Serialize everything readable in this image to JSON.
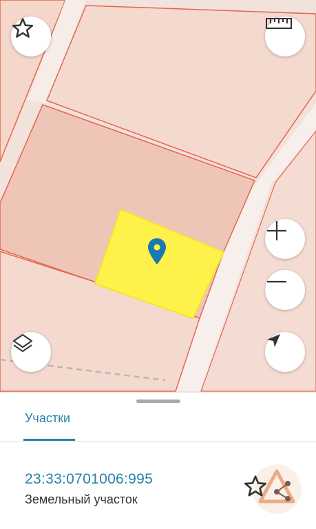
{
  "map": {
    "favorite_icon": "star-outline-icon",
    "ruler_icon": "ruler-icon",
    "zoom_in_icon": "plus-icon",
    "zoom_out_icon": "minus-icon",
    "layers_icon": "layers-icon",
    "locate_icon": "navigation-arrow-icon",
    "marker_icon": "map-pin-icon",
    "colors": {
      "background": "#f2e2dc",
      "parcel": "#efc8bc",
      "parcel_border": "#e5654e",
      "selected_parcel": "#fef24a",
      "marker": "#1b78b3"
    }
  },
  "sheet": {
    "tab_label": "Участки",
    "parcel": {
      "cadastral_number": "23:33:0701006:995",
      "type": "Земельный участок"
    },
    "favorite_icon": "star-outline-icon",
    "watermark_icon": "share-logo-icon",
    "accent_color": "#2a7fa8"
  }
}
